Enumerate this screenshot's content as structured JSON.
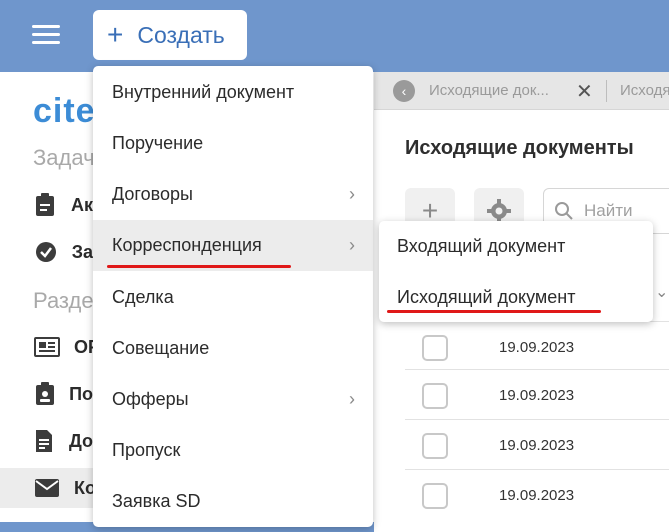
{
  "topbar": {
    "create_plus": "+",
    "create_label": "Создать",
    "bg_color": "#6f96cc",
    "accent_color": "#3a6fb7"
  },
  "sidebar": {
    "logo_text": "cite",
    "heading_tasks": "Задач",
    "heading_sections": "Разде",
    "items": [
      {
        "icon": "clipboard-icon",
        "label": "Ак"
      },
      {
        "icon": "check-circle-icon",
        "label": "За"
      },
      {
        "icon": "newspaper-icon",
        "label": "ОР"
      },
      {
        "icon": "clipboard-person-icon",
        "label": "По"
      },
      {
        "icon": "document-icon",
        "label": "До"
      },
      {
        "icon": "envelope-icon",
        "label": "Ко"
      }
    ]
  },
  "tabs": {
    "tab1_label": "Исходящие док...",
    "tab2_label": "Исходя"
  },
  "main": {
    "title": "Исходящие документы",
    "search_placeholder": "Найти",
    "rows": [
      {
        "date": "19.09.2023"
      },
      {
        "date": "19.09.2023"
      },
      {
        "date": "19.09.2023"
      },
      {
        "date": "19.09.2023"
      }
    ]
  },
  "menu": {
    "items": [
      {
        "label": "Внутренний документ",
        "has_submenu": false
      },
      {
        "label": "Поручение",
        "has_submenu": false
      },
      {
        "label": "Договоры",
        "has_submenu": true
      },
      {
        "label": "Корреспонденция",
        "has_submenu": true
      },
      {
        "label": "Сделка",
        "has_submenu": false
      },
      {
        "label": "Совещание",
        "has_submenu": false
      },
      {
        "label": "Офферы",
        "has_submenu": true
      },
      {
        "label": "Пропуск",
        "has_submenu": false
      },
      {
        "label": "Заявка SD",
        "has_submenu": false
      }
    ],
    "highlight_color": "#e01818"
  },
  "submenu": {
    "items": [
      {
        "label": "Входящий документ"
      },
      {
        "label": "Исходящий документ"
      }
    ]
  }
}
